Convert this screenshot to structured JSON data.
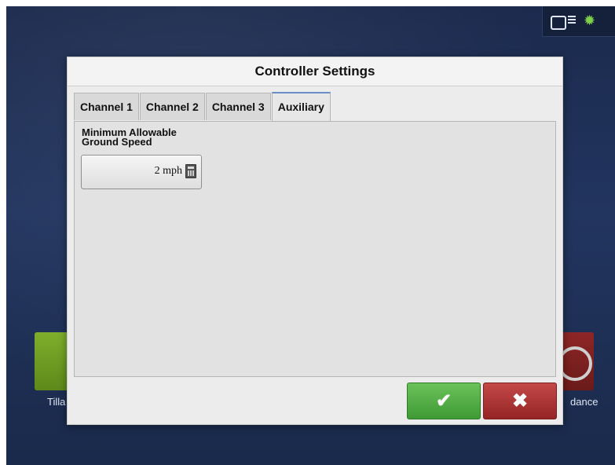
{
  "dialog": {
    "title": "Controller Settings",
    "tabs": [
      {
        "label": "Channel 1"
      },
      {
        "label": "Channel 2"
      },
      {
        "label": "Channel 3"
      },
      {
        "label": "Auxiliary"
      }
    ],
    "active_tab": "Auxiliary",
    "fields": {
      "min_ground_speed_label_line1": "Minimum Allowable",
      "min_ground_speed_label_line2": "Ground Speed",
      "min_ground_speed_value": "2 mph"
    },
    "buttons": {
      "ok_symbol": "✔",
      "cancel_symbol": "✖"
    }
  },
  "background": {
    "left_tile_label": "Tilla",
    "right_tile_label": "dance"
  },
  "status": {
    "icons": [
      "gps-status-icon",
      "satellite-icon"
    ]
  },
  "colors": {
    "ok_button": "#4caf3f",
    "cancel_button": "#b03333",
    "active_tab_accent": "#6a8fc7"
  }
}
